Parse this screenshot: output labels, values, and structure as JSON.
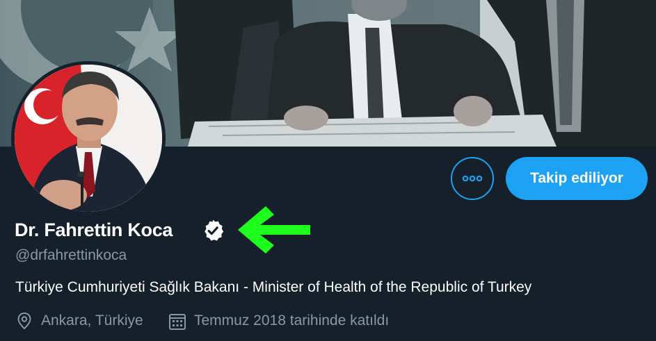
{
  "profile": {
    "display_name": "Dr. Fahrettin Koca",
    "handle": "@drfahrettinkoca",
    "bio": "Türkiye Cumhuriyeti Sağlık Bakanı - Minister of Health of the Republic of Turkey",
    "location": "Ankara, Türkiye",
    "joined": "Temmuz 2018 tarihinde katıldı",
    "verified": true
  },
  "actions": {
    "follow_label": "Takip ediliyor",
    "more_icon": "more-icon"
  },
  "annotation": {
    "arrow_color": "#1eff1e",
    "arrow_icon": "arrow-left-icon"
  },
  "colors": {
    "background": "#15202b",
    "accent": "#1da1f2",
    "secondary_text": "#8899a6",
    "primary_text": "#ffffff"
  }
}
